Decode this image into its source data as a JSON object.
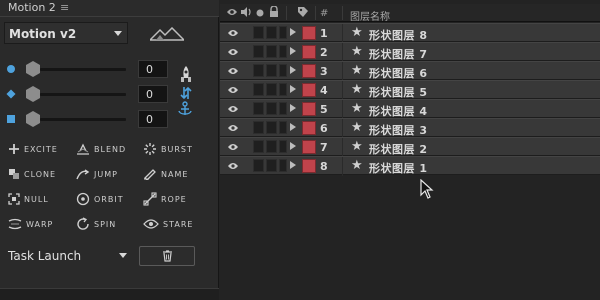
{
  "panel": {
    "title": "Motion 2",
    "menu_icon": "hamburger-icon"
  },
  "preset": {
    "selected": "Motion v2",
    "icon": "mountain-icon"
  },
  "sliders": [
    {
      "icon": "dot-icon",
      "value": "0"
    },
    {
      "icon": "diamond-icon",
      "value": "0"
    },
    {
      "icon": "square-icon",
      "value": "0"
    }
  ],
  "side_icons": [
    "rocket-icon",
    "swap-icon",
    "anchor-icon"
  ],
  "actions": [
    {
      "label": "EXCITE",
      "icon": "plus-icon"
    },
    {
      "label": "BLEND",
      "icon": "blend-icon"
    },
    {
      "label": "BURST",
      "icon": "burst-icon"
    },
    {
      "label": "CLONE",
      "icon": "clone-icon"
    },
    {
      "label": "JUMP",
      "icon": "jump-icon"
    },
    {
      "label": "NAME",
      "icon": "pencil-icon"
    },
    {
      "label": "NULL",
      "icon": "null-icon"
    },
    {
      "label": "ORBIT",
      "icon": "orbit-icon"
    },
    {
      "label": "ROPE",
      "icon": "rope-icon"
    },
    {
      "label": "WARP",
      "icon": "warp-icon"
    },
    {
      "label": "SPIN",
      "icon": "spin-icon"
    },
    {
      "label": "STARE",
      "icon": "eye-icon"
    }
  ],
  "task": {
    "selected": "Task Launch",
    "delete_icon": "trash-icon"
  },
  "layers_header": {
    "number_label": "#",
    "name_label": "图层名称",
    "icons": [
      "eye-icon",
      "audio-icon",
      "solo-icon",
      "lock-icon",
      "label-icon"
    ]
  },
  "layers": [
    {
      "number": "1",
      "name": "形状图层 8"
    },
    {
      "number": "2",
      "name": "形状图层 7"
    },
    {
      "number": "3",
      "name": "形状图层 6"
    },
    {
      "number": "4",
      "name": "形状图层 5"
    },
    {
      "number": "5",
      "name": "形状图层 4"
    },
    {
      "number": "6",
      "name": "形状图层 3"
    },
    {
      "number": "7",
      "name": "形状图层 2"
    },
    {
      "number": "8",
      "name": "形状图层 1"
    }
  ],
  "colors": {
    "accent_blue": "#4ea2dd",
    "label_red": "#c0434b",
    "row_bg": "#383838"
  }
}
